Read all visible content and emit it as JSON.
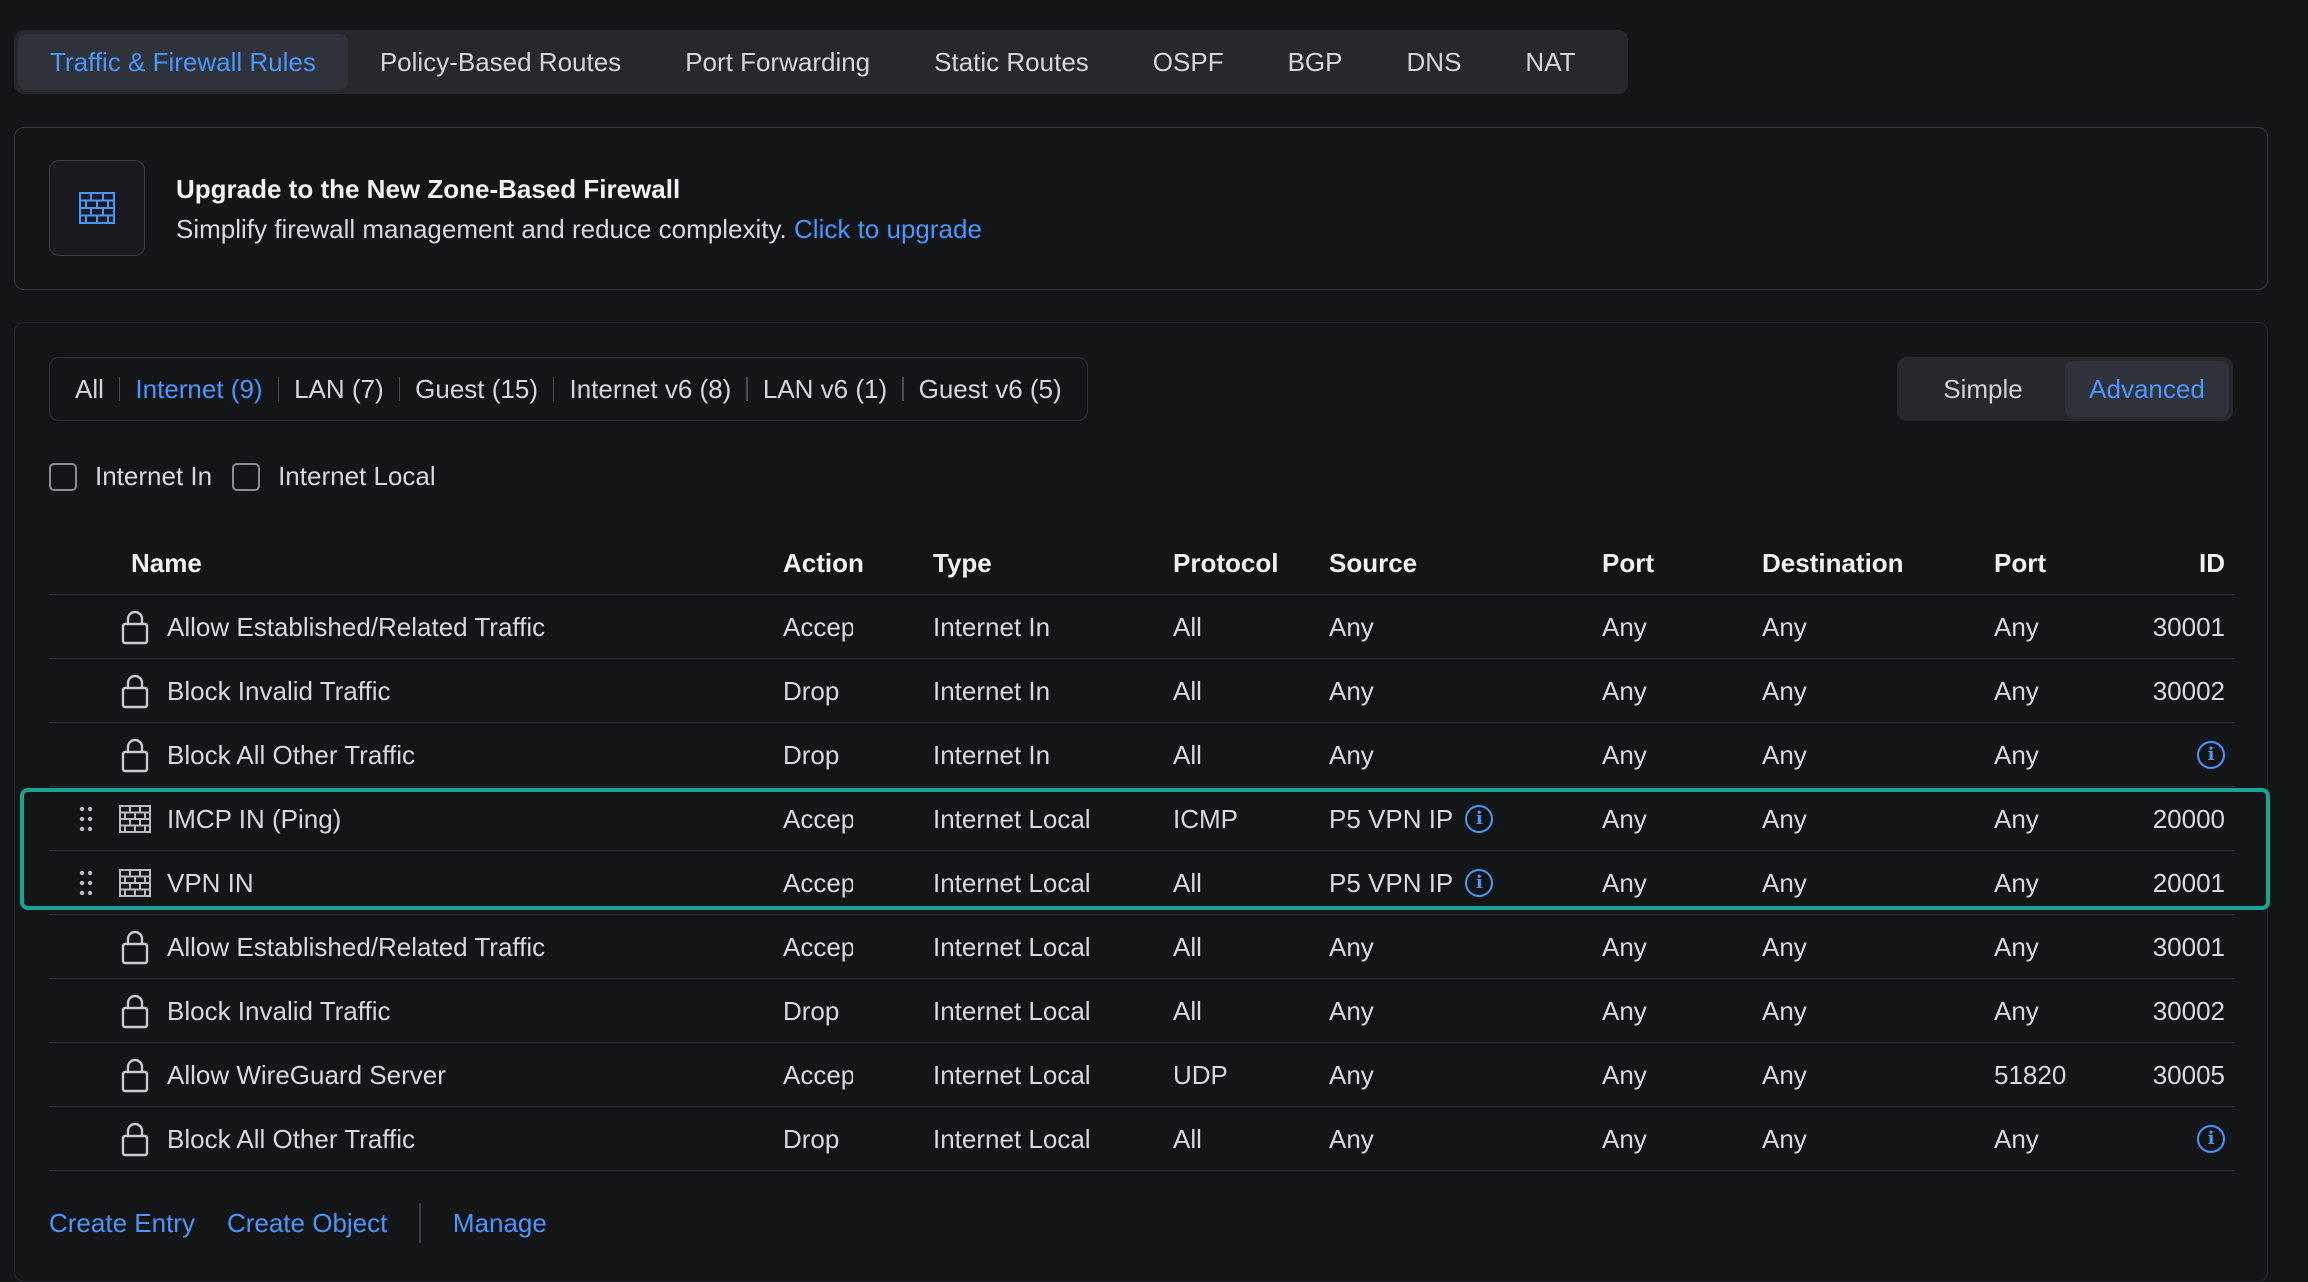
{
  "tabs": [
    {
      "label": "Traffic & Firewall Rules"
    },
    {
      "label": "Policy-Based Routes"
    },
    {
      "label": "Port Forwarding"
    },
    {
      "label": "Static Routes"
    },
    {
      "label": "OSPF"
    },
    {
      "label": "BGP"
    },
    {
      "label": "DNS"
    },
    {
      "label": "NAT"
    }
  ],
  "banner": {
    "icon": "firewall-icon",
    "title": "Upgrade to the New Zone-Based Firewall",
    "text": "Simplify firewall management and reduce complexity.",
    "link": "Click to upgrade"
  },
  "filters": [
    {
      "label": "All"
    },
    {
      "label": "Internet (9)"
    },
    {
      "label": "LAN (7)"
    },
    {
      "label": "Guest (15)"
    },
    {
      "label": "Internet v6 (8)"
    },
    {
      "label": "LAN v6 (1)"
    },
    {
      "label": "Guest v6 (5)"
    }
  ],
  "active_filter": "Internet (9)",
  "view_toggle": {
    "simple": "Simple",
    "advanced": "Advanced",
    "active": "Advanced"
  },
  "checkboxes": [
    {
      "label": "Internet In",
      "checked": false
    },
    {
      "label": "Internet Local",
      "checked": false
    }
  ],
  "table": {
    "headers": {
      "name": "Name",
      "action": "Action",
      "type": "Type",
      "protocol": "Protocol",
      "source": "Source",
      "port": "Port",
      "destination": "Destination",
      "dport": "Port",
      "id": "ID"
    },
    "rows": [
      {
        "icon": "lock-icon",
        "name": "Allow Established/Related Traffic",
        "action": "Accept",
        "type": "Internet In",
        "protocol": "All",
        "source": "Any",
        "port": "Any",
        "destination": "Any",
        "dport": "Any",
        "id": "30001"
      },
      {
        "icon": "lock-icon",
        "name": "Block Invalid Traffic",
        "action": "Drop",
        "type": "Internet In",
        "protocol": "All",
        "source": "Any",
        "port": "Any",
        "destination": "Any",
        "dport": "Any",
        "id": "30002"
      },
      {
        "icon": "lock-icon",
        "name": "Block All Other Traffic",
        "action": "Drop",
        "type": "Internet In",
        "protocol": "All",
        "source": "Any",
        "port": "Any",
        "destination": "Any",
        "dport": "Any",
        "id": ""
      },
      {
        "icon": "firewall-icon",
        "name": "IMCP IN (Ping)",
        "action": "Accept",
        "type": "Internet Local",
        "protocol": "ICMP",
        "source": "P5 VPN IP",
        "port": "Any",
        "destination": "Any",
        "dport": "Any",
        "id": "20000"
      },
      {
        "icon": "firewall-icon",
        "name": "VPN IN",
        "action": "Accept",
        "type": "Internet Local",
        "protocol": "All",
        "source": "P5 VPN IP",
        "port": "Any",
        "destination": "Any",
        "dport": "Any",
        "id": "20001"
      },
      {
        "icon": "lock-icon",
        "name": "Allow Established/Related Traffic",
        "action": "Accept",
        "type": "Internet Local",
        "protocol": "All",
        "source": "Any",
        "port": "Any",
        "destination": "Any",
        "dport": "Any",
        "id": "30001"
      },
      {
        "icon": "lock-icon",
        "name": "Block Invalid Traffic",
        "action": "Drop",
        "type": "Internet Local",
        "protocol": "All",
        "source": "Any",
        "port": "Any",
        "destination": "Any",
        "dport": "Any",
        "id": "30002"
      },
      {
        "icon": "lock-icon",
        "name": "Allow WireGuard Server",
        "action": "Accept",
        "type": "Internet Local",
        "protocol": "UDP",
        "source": "Any",
        "port": "Any",
        "destination": "Any",
        "dport": "51820",
        "id": "30005"
      },
      {
        "icon": "lock-icon",
        "name": "Block All Other Traffic",
        "action": "Drop",
        "type": "Internet Local",
        "protocol": "All",
        "source": "Any",
        "port": "Any",
        "destination": "Any",
        "dport": "Any",
        "id": ""
      }
    ]
  },
  "footer": {
    "create_entry": "Create Entry",
    "create_object": "Create Object",
    "manage": "Manage"
  },
  "colors": {
    "accent": "#4797ff",
    "highlight": "#17a596",
    "background": "#141517"
  }
}
